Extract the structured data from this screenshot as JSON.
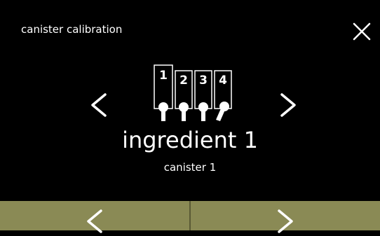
{
  "header": {
    "title": "canister calibration",
    "close_icon": "close-icon"
  },
  "selector": {
    "prev_icon": "chevron-left-icon",
    "next_icon": "chevron-right-icon",
    "canister_numbers": [
      "1",
      "2",
      "3",
      "4"
    ],
    "selected_index": 0,
    "ingredient_label": "ingredient 1",
    "canister_label": "canister 1"
  },
  "footer": {
    "prev_icon": "chevron-left-icon",
    "next_icon": "chevron-right-icon",
    "button_color": "#8a8a55"
  },
  "colors": {
    "background": "#000000",
    "foreground": "#ffffff",
    "accent": "#8a8a55"
  }
}
